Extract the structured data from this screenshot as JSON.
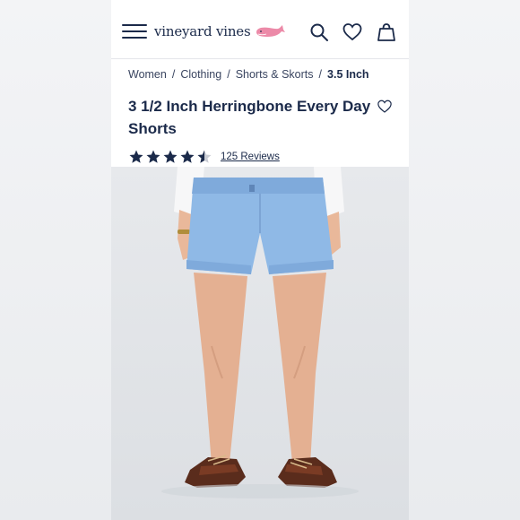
{
  "header": {
    "menu_icon": "hamburger-menu-icon",
    "brand": "vineyard vines",
    "brand_icon": "whale-logo-icon",
    "search_icon": "search-icon",
    "wishlist_icon": "heart-icon",
    "bag_icon": "shopping-bag-icon"
  },
  "breadcrumb": {
    "items": [
      "Women",
      "Clothing",
      "Shorts & Skorts",
      "3.5 Inch"
    ],
    "separator": "/"
  },
  "product": {
    "title": "3 1/2 Inch Herringbone Every Day Shorts",
    "rating": 4.5,
    "rating_max": 5,
    "reviews_label": "125 Reviews",
    "add_to_wishlist_icon": "heart-outline-icon",
    "image_alt": "Model wearing light blue shorts with brown boat shoes"
  },
  "colors": {
    "navy": "#1b2a4a",
    "whale_pink": "#ec8aa8",
    "shorts_blue": "#8fb9e6"
  }
}
